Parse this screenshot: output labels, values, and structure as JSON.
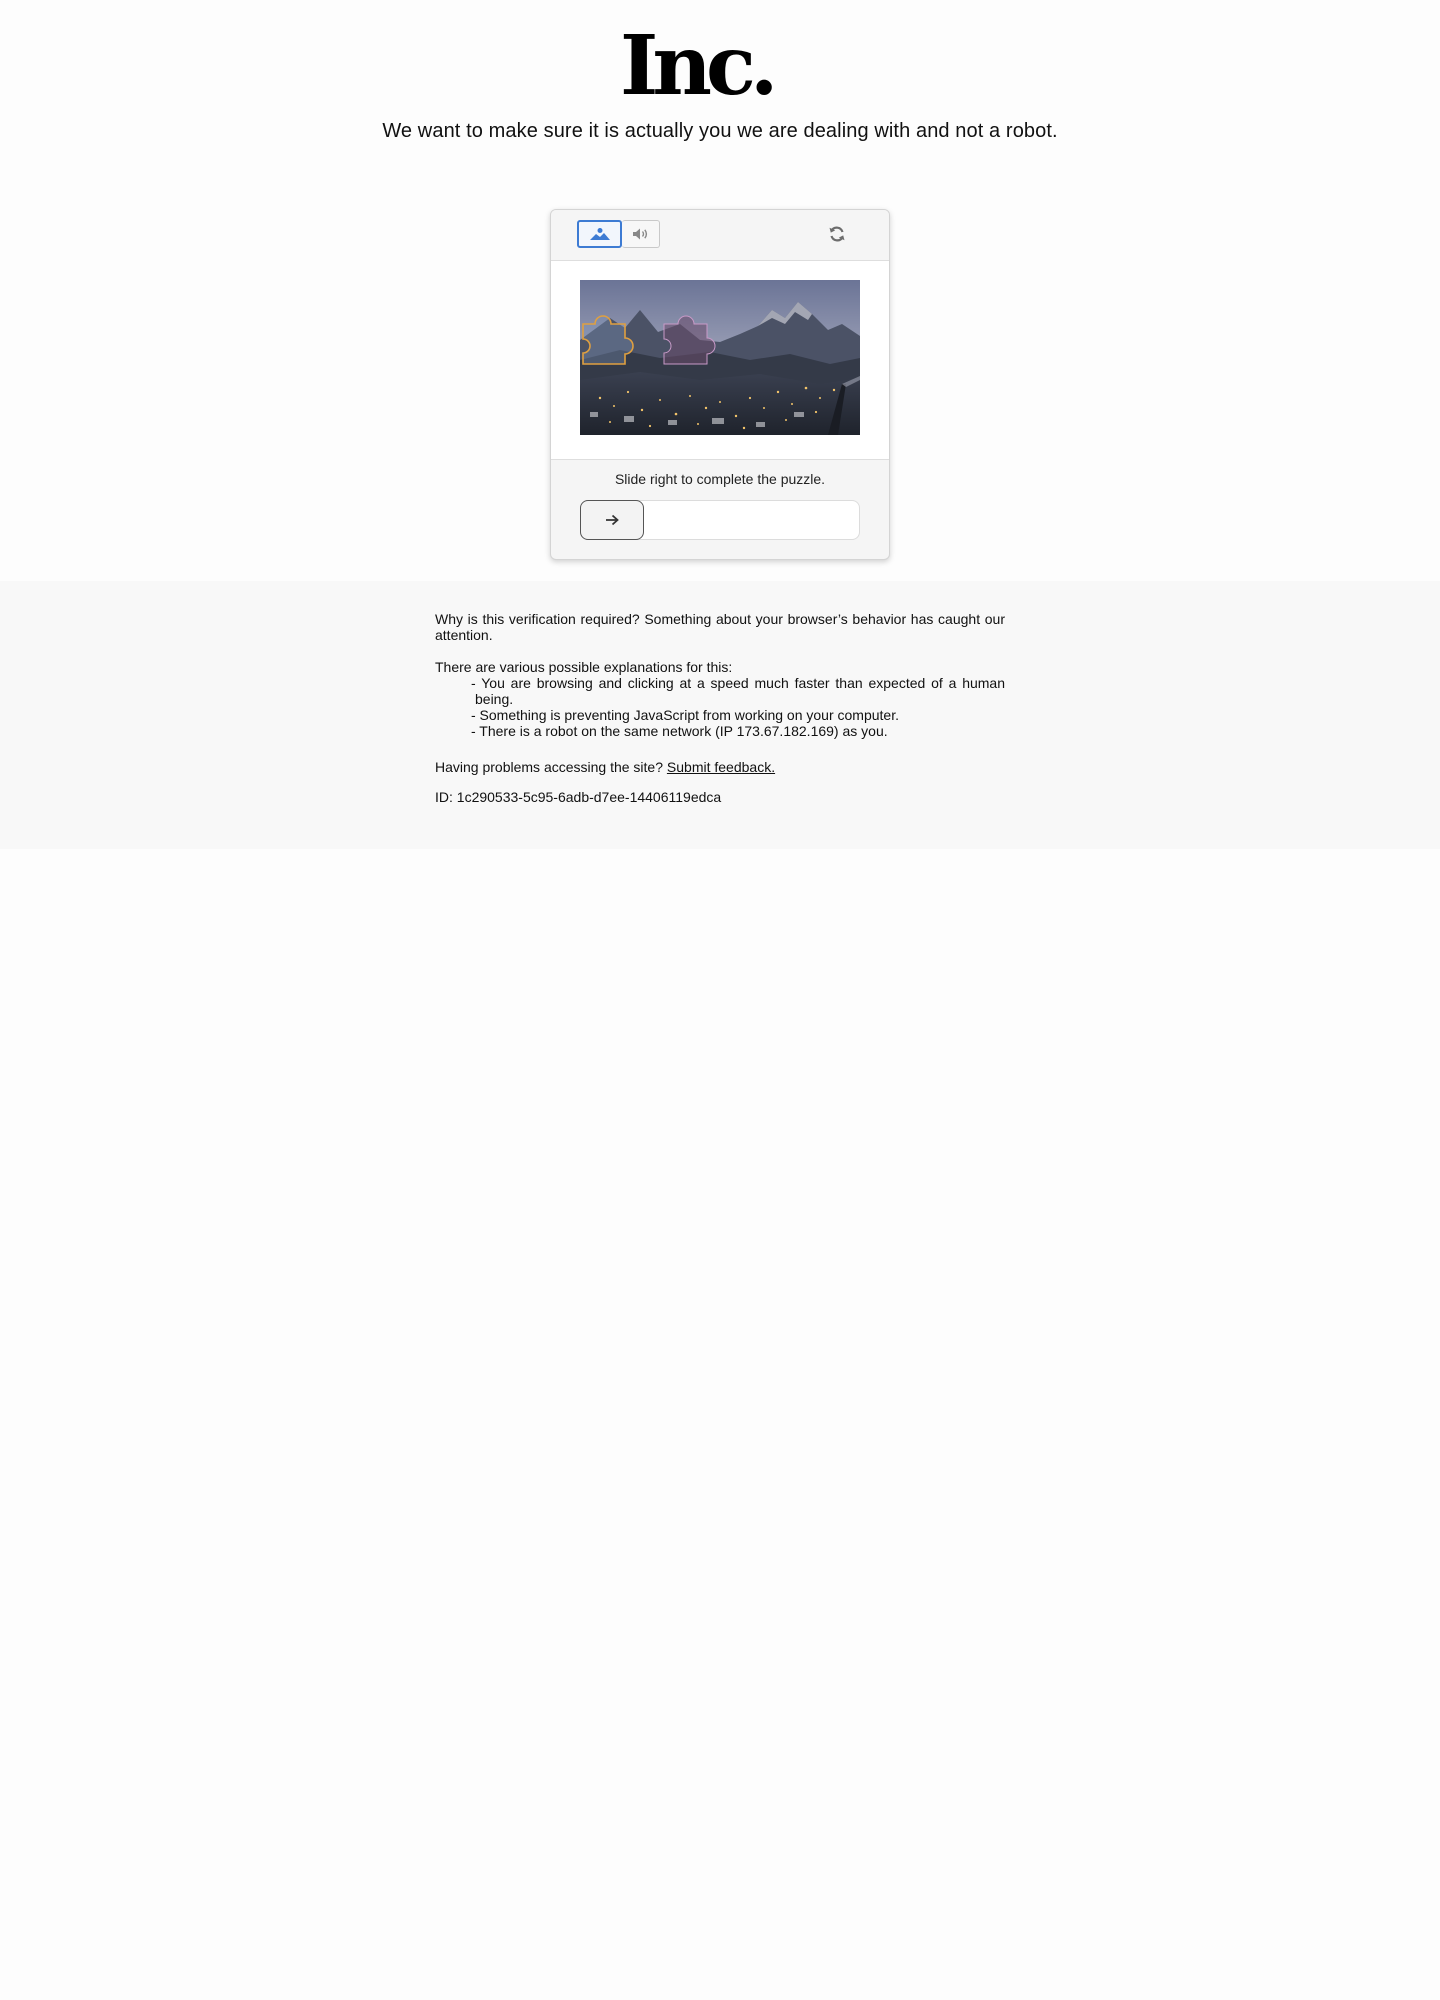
{
  "brand": {
    "logo_text": "Inc."
  },
  "header": {
    "subtitle": "We want to make sure it is actually you we are dealing with and not a robot."
  },
  "captcha": {
    "modes": [
      {
        "name": "image",
        "icon": "mountain-image-icon",
        "selected": true
      },
      {
        "name": "audio",
        "icon": "speaker-icon",
        "selected": false
      }
    ],
    "refresh_icon": "refresh-icon",
    "instruction": "Slide right to complete the puzzle.",
    "slider_icon": "arrow-right-icon",
    "slider_progress": 0,
    "colors": {
      "selected_border": "#3d7bd3",
      "handle_border": "#555555",
      "puzzle_outline": "#e0a040"
    }
  },
  "info": {
    "why": "Why is this verification required? Something about your browser’s behavior has caught our attention.",
    "explanations_intro": "There are various possible explanations for this:",
    "explanations": [
      "- You are browsing and clicking at a speed much faster than expected of a human being.",
      "- Something is preventing JavaScript from working on your computer.",
      "- There is a robot on the same network (IP 173.67.182.169) as you."
    ],
    "problems_text": "Having problems accessing the site?",
    "feedback_link": "Submit feedback.",
    "id_text": "ID: 1c290533-5c95-6adb-d7ee-14406119edca"
  }
}
